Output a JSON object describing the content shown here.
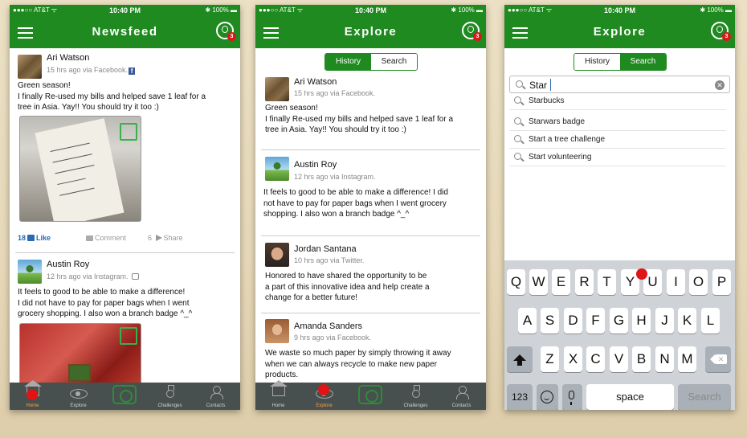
{
  "status": {
    "carrier": "●●●○○ AT&T ᯤ",
    "time": "10:40 PM",
    "battery": "✱ 100% ▬"
  },
  "notif_badge": "3",
  "tabbar": {
    "home": "Home",
    "explore": "Explore",
    "challenges": "Challenges",
    "contacts": "Contacts"
  },
  "newsfeed": {
    "title": "Newsfeed",
    "post1": {
      "name": "Ari Watson",
      "meta": "15 hrs ago via Facebook.",
      "text": "Green season!\nI finally Re-used my bills and helped save 1 leaf for a\ntree in Asia. Yay!! You should try it too :)",
      "likes": "18",
      "like_label": "Like",
      "comment_label": "Comment",
      "shares": "6",
      "share_label": "Share"
    },
    "post2": {
      "name": "Austin Roy",
      "meta": "12 hrs ago via Instagram.",
      "text": "It feels to good to be able to make a difference!\nI did not have to pay for paper bags when I went\ngrocery shopping. I also won a branch badge ^_^"
    }
  },
  "explore_history": {
    "title": "Explore",
    "seg": {
      "history": "History",
      "search": "Search"
    },
    "posts": [
      {
        "name": "Ari Watson",
        "meta": "15 hrs ago via Facebook.",
        "text": "Green season!\nI finally Re-used my bills and helped save 1 leaf for a\ntree in Asia. Yay!! You should try it too :)"
      },
      {
        "name": "Austin Roy",
        "meta": "12 hrs ago via Instagram.",
        "text": "It feels to good to be able to make a difference! I did\nnot have to pay for paper bags when I went grocery\nshopping. I also won a branch badge ^_^"
      },
      {
        "name": "Jordan Santana",
        "meta": "10 hrs ago via Twitter.",
        "text": "Honored to have shared the opportunity to be\na part of this innovative idea and help create a\nchange for a better future!"
      },
      {
        "name": "Amanda Sanders",
        "meta": "9 hrs ago via Facebook.",
        "text": "We waste so much paper by simply throwing it away\nwhen we can always recycle to make new paper\nproducts."
      }
    ]
  },
  "explore_search": {
    "title": "Explore",
    "seg": {
      "history": "History",
      "search": "Search"
    },
    "query": "Star",
    "suggestions": [
      "Starbucks",
      "Starwars badge",
      "Start a tree challenge",
      "Start volunteering"
    ]
  },
  "keyboard": {
    "row1": [
      "Q",
      "W",
      "E",
      "R",
      "T",
      "Y",
      "U",
      "I",
      "O",
      "P"
    ],
    "row2": [
      "A",
      "S",
      "D",
      "F",
      "G",
      "H",
      "J",
      "K",
      "L"
    ],
    "row3": [
      "Z",
      "X",
      "C",
      "V",
      "B",
      "N",
      "M"
    ],
    "num_label": "123",
    "space_label": "space",
    "search_label": "Search"
  },
  "colors": {
    "brand_green": "#1f8a1f",
    "tabbar": "#47504e",
    "tap_marker": "#e01414",
    "active_tab": "#f2a24a"
  }
}
